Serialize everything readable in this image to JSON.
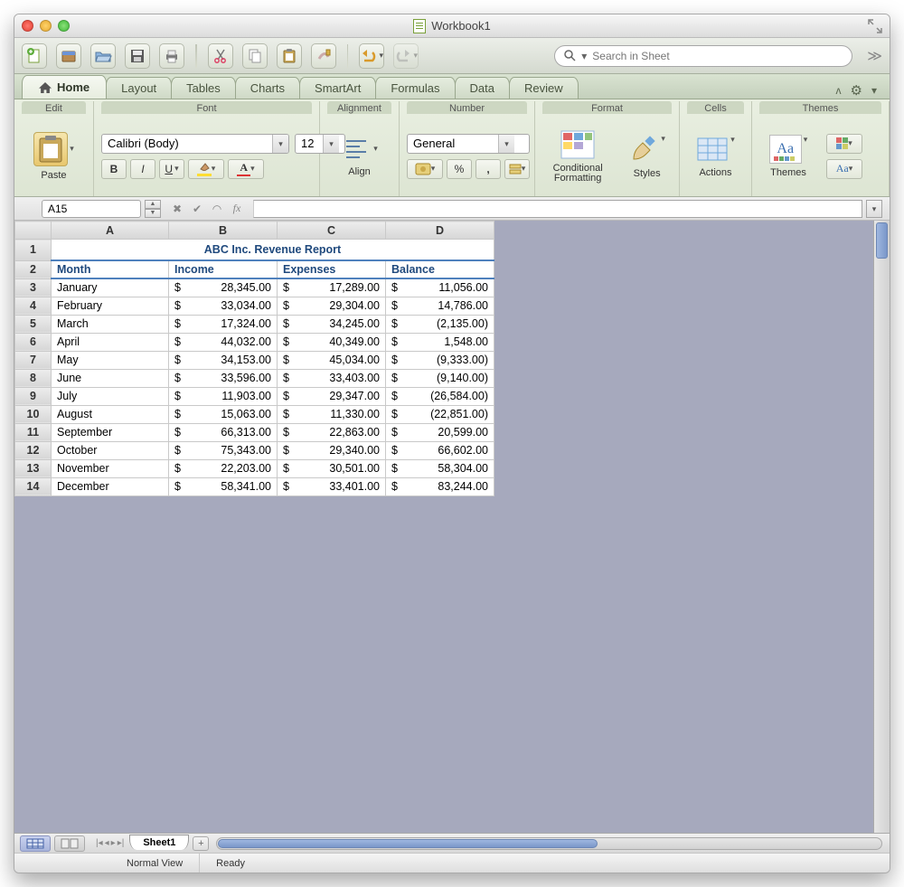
{
  "window": {
    "title": "Workbook1"
  },
  "qat": {
    "search_placeholder": "Search in Sheet",
    "buttons": [
      "new",
      "open",
      "import",
      "save",
      "print",
      "cut",
      "copy",
      "paste",
      "format-painter",
      "undo",
      "redo"
    ]
  },
  "tabs": {
    "items": [
      "Home",
      "Layout",
      "Tables",
      "Charts",
      "SmartArt",
      "Formulas",
      "Data",
      "Review"
    ],
    "active": 0
  },
  "ribbon": {
    "groups": {
      "edit": {
        "title": "Edit",
        "paste_label": "Paste"
      },
      "font": {
        "title": "Font",
        "font_name": "Calibri (Body)",
        "font_size": "12",
        "bold": "B",
        "italic": "I",
        "underline": "U"
      },
      "alignment": {
        "title": "Alignment",
        "align_label": "Align"
      },
      "number": {
        "title": "Number",
        "format": "General",
        "currency": "$",
        "percent": "%",
        "comma": ","
      },
      "format": {
        "title": "Format",
        "cond_label": "Conditional Formatting",
        "styles_label": "Styles"
      },
      "cells": {
        "title": "Cells",
        "actions_label": "Actions"
      },
      "themes": {
        "title": "Themes",
        "themes_label": "Themes",
        "aa": "Aa"
      }
    }
  },
  "formula_bar": {
    "cell_ref": "A15",
    "formula": ""
  },
  "sheet": {
    "columns": [
      "A",
      "B",
      "C",
      "D"
    ],
    "title": "ABC Inc. Revenue Report",
    "headers": [
      "Month",
      "Income",
      "Expenses",
      "Balance"
    ],
    "rows": [
      {
        "month": "January",
        "income": "28,345.00",
        "expenses": "17,289.00",
        "balance": "11,056.00"
      },
      {
        "month": "February",
        "income": "33,034.00",
        "expenses": "29,304.00",
        "balance": "14,786.00"
      },
      {
        "month": "March",
        "income": "17,324.00",
        "expenses": "34,245.00",
        "balance": "(2,135.00)"
      },
      {
        "month": "April",
        "income": "44,032.00",
        "expenses": "40,349.00",
        "balance": "1,548.00"
      },
      {
        "month": "May",
        "income": "34,153.00",
        "expenses": "45,034.00",
        "balance": "(9,333.00)"
      },
      {
        "month": "June",
        "income": "33,596.00",
        "expenses": "33,403.00",
        "balance": "(9,140.00)"
      },
      {
        "month": "July",
        "income": "11,903.00",
        "expenses": "29,347.00",
        "balance": "(26,584.00)"
      },
      {
        "month": "August",
        "income": "15,063.00",
        "expenses": "11,330.00",
        "balance": "(22,851.00)"
      },
      {
        "month": "September",
        "income": "66,313.00",
        "expenses": "22,863.00",
        "balance": "20,599.00"
      },
      {
        "month": "October",
        "income": "75,343.00",
        "expenses": "29,340.00",
        "balance": "66,602.00"
      },
      {
        "month": "November",
        "income": "22,203.00",
        "expenses": "30,501.00",
        "balance": "58,304.00"
      },
      {
        "month": "December",
        "income": "58,341.00",
        "expenses": "33,401.00",
        "balance": "83,244.00"
      }
    ]
  },
  "sheet_tabs": {
    "active": "Sheet1"
  },
  "status": {
    "view": "Normal View",
    "state": "Ready"
  },
  "chart_data": {
    "type": "table",
    "title": "ABC Inc. Revenue Report",
    "columns": [
      "Month",
      "Income",
      "Expenses",
      "Balance"
    ],
    "rows": [
      [
        "January",
        28345.0,
        17289.0,
        11056.0
      ],
      [
        "February",
        33034.0,
        29304.0,
        14786.0
      ],
      [
        "March",
        17324.0,
        34245.0,
        -2135.0
      ],
      [
        "April",
        44032.0,
        40349.0,
        1548.0
      ],
      [
        "May",
        34153.0,
        45034.0,
        -9333.0
      ],
      [
        "June",
        33596.0,
        33403.0,
        -9140.0
      ],
      [
        "July",
        11903.0,
        29347.0,
        -26584.0
      ],
      [
        "August",
        15063.0,
        11330.0,
        -22851.0
      ],
      [
        "September",
        66313.0,
        22863.0,
        20599.0
      ],
      [
        "October",
        75343.0,
        29340.0,
        66602.0
      ],
      [
        "November",
        22203.0,
        30501.0,
        58304.0
      ],
      [
        "December",
        58341.0,
        33401.0,
        83244.0
      ]
    ]
  }
}
